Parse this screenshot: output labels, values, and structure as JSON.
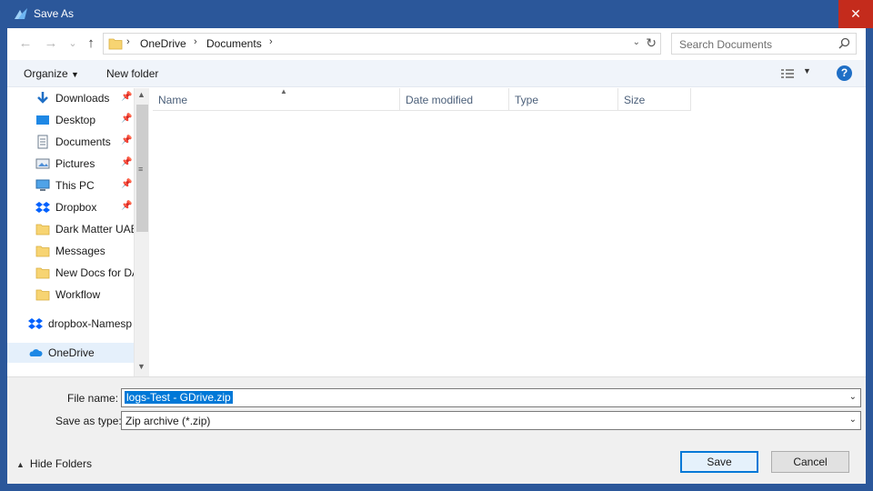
{
  "window": {
    "title": "Save As",
    "close_symbol": "✕"
  },
  "address": {
    "back_symbol": "←",
    "forward_symbol": "→",
    "recent_symbol": "⌄",
    "up_symbol": "↑",
    "breadcrumb": [
      "OneDrive",
      "Documents"
    ],
    "separator": "›",
    "refresh_symbol": "↻"
  },
  "search": {
    "placeholder": "Search Documents"
  },
  "toolbar": {
    "organize_label": "Organize",
    "new_folder_label": "New folder",
    "help_label": "?"
  },
  "nav_pane": {
    "items": [
      {
        "label": "Downloads",
        "icon": "download-arrow-icon",
        "pinned": true
      },
      {
        "label": "Desktop",
        "icon": "desktop-icon",
        "pinned": true
      },
      {
        "label": "Documents",
        "icon": "documents-icon",
        "pinned": true
      },
      {
        "label": "Pictures",
        "icon": "pictures-icon",
        "pinned": true
      },
      {
        "label": "This PC",
        "icon": "computer-icon",
        "pinned": true
      },
      {
        "label": "Dropbox",
        "icon": "dropbox-icon",
        "pinned": true
      },
      {
        "label": "Dark Matter UAE",
        "icon": "folder-icon",
        "pinned": false
      },
      {
        "label": "Messages",
        "icon": "folder-icon",
        "pinned": false
      },
      {
        "label": "New Docs for DA",
        "icon": "folder-icon",
        "pinned": false
      },
      {
        "label": "Workflow",
        "icon": "folder-icon",
        "pinned": false
      },
      {
        "label": "dropbox-Namesp",
        "icon": "dropbox-icon",
        "pinned": false
      },
      {
        "label": "OneDrive",
        "icon": "onedrive-cloud-icon",
        "pinned": false,
        "selected": true
      }
    ]
  },
  "columns": [
    "Name",
    "Date modified",
    "Type",
    "Size"
  ],
  "form": {
    "file_name_label": "File name:",
    "file_name_value": "logs-Test - GDrive.zip",
    "save_type_label": "Save as type:",
    "save_type_value": "Zip archive (*.zip)"
  },
  "footer": {
    "hide_folders_label": "Hide Folders",
    "save_label": "Save",
    "cancel_label": "Cancel"
  },
  "colors": {
    "title_bar": "#2b579a",
    "close_button": "#c42b1c",
    "selection": "#0078d7",
    "command_bar": "#f0f4fa"
  }
}
